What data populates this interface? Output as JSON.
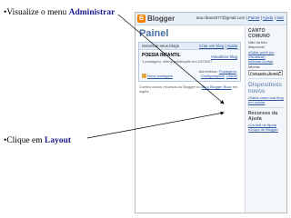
{
  "bullets": [
    {
      "prefix": "•Visualize o menu ",
      "keyword": "Administrar"
    },
    {
      "prefix": "•Clique em ",
      "keyword": "Layout"
    }
  ],
  "header": {
    "logo_letter": "B",
    "logo_text": "Blogger",
    "account": "asa.ribas1977@gmail.com",
    "links": [
      "Painel",
      "Ajuda",
      "Sair"
    ]
  },
  "main": {
    "title": "Painel",
    "panel_header_left": "Gerencie seus blogs",
    "panel_header_links": [
      "Criar um blog",
      "Ajuda"
    ],
    "blog": {
      "name": "POESIA INFANTIL",
      "post_info": "1 postagem, última publicação em 22/05/07",
      "view_link": "Visualizar blog",
      "new_post": "Nova postagem",
      "admin_label": "Administrar:",
      "admin_links": [
        "Postagens",
        "Configurações",
        "Layout"
      ]
    },
    "footer_text": "Confira outros recursos do Blogger no ",
    "footer_link": "Blog Blogger Buzz",
    "footer_text2": " em inglês."
  },
  "sidebar": {
    "profile_title": "CANTO COMUNO",
    "profile_text": "Não há foto disponível",
    "profile_links": [
      "Editar perfil (ou Visualizar)",
      "Minhas contas"
    ],
    "language_label": "Idioma:",
    "language_value": "Português (Brasil)",
    "news_title": "Dispositivos novos",
    "news_link": "Saiba como sua blog em celular",
    "help_title": "Recursos da Ajuda",
    "help_links": [
      "Central de Ajuda",
      "Grupo de Blogger"
    ]
  },
  "colors": {
    "keyword": "#1a1a8c",
    "accent": "#4a6fa5",
    "link": "#2a55a0",
    "logo": "#f57d00"
  }
}
